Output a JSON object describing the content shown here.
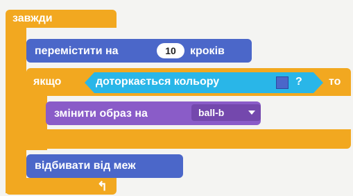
{
  "forever": {
    "label": "завжди",
    "loop_arrow": "↰"
  },
  "move": {
    "prefix": "перемістити на",
    "steps_value": "10",
    "suffix": "кроків"
  },
  "if_block": {
    "if_label": "якщо",
    "then_label": "то",
    "condition": {
      "label": "доторкається кольору",
      "question_mark": "?",
      "color_swatch": "#4b67c9"
    }
  },
  "switch_costume": {
    "label": "змінити образ на",
    "costume_value": "ball-b",
    "dropdown_icon": "chevron-down-icon"
  },
  "bounce": {
    "label": "відбивати від меж"
  },
  "colors": {
    "control": "#f2a820",
    "motion": "#4b67c9",
    "looks": "#8a5cc8",
    "sensing": "#29b6e8"
  }
}
